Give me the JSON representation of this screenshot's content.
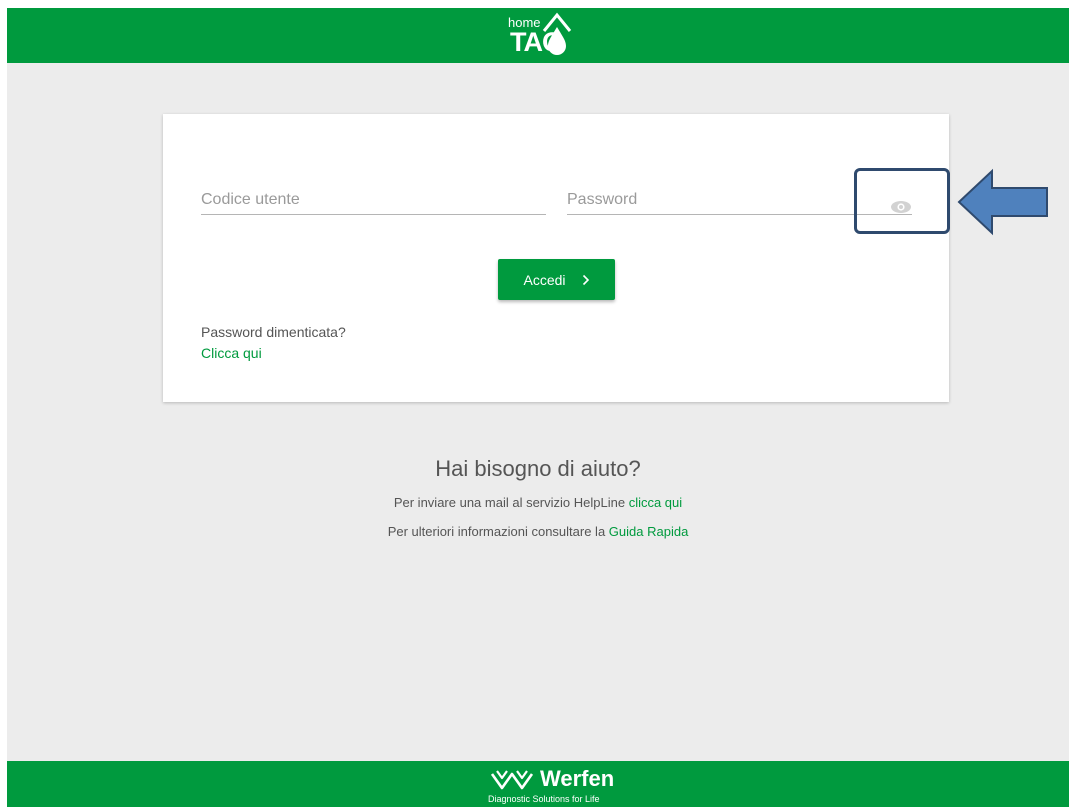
{
  "header": {
    "logo_home": "home",
    "logo_tao": "TAO"
  },
  "login": {
    "user_placeholder": "Codice utente",
    "password_placeholder": "Password",
    "submit_label": "Accedi",
    "submit_icon": "chevron-right-icon",
    "show_password_icon": "eye-icon",
    "forgot_text": "Password dimenticata?",
    "forgot_link": "Clicca qui"
  },
  "help": {
    "title": "Hai bisogno di aiuto?",
    "line1_text": "Per inviare una mail al servizio HelpLine ",
    "line1_link": "clicca qui",
    "line2_text": "Per ulteriori informazioni consultare la ",
    "line2_link": "Guida Rapida"
  },
  "footer": {
    "brand": "Werfen",
    "tagline": "Diagnostic Solutions for Life"
  },
  "colors": {
    "brand_green": "#009a3e",
    "background": "#ececec",
    "annotation_blue": "#4f81bd",
    "annotation_border": "#2f4a6e"
  }
}
